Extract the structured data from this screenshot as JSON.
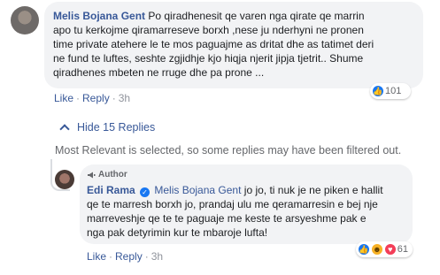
{
  "main_comment": {
    "author": "Melis Bojana Gent",
    "lines": [
      "Po qiradhenesit qe varen nga qirate qe marrin",
      "apo tu kerkojme qiramarreseve borxh ,nese ju nderhyni ne pronen",
      "time private atehere le te mos paguajme as dritat dhe as tatimet deri",
      "ne fund te luftes, seshte zgjidhje kjo hiqja njerit jipja tjetrit.. Shume",
      "qiradhenes mbeten ne rruge dhe pa prone ..."
    ],
    "reaction_count": "101",
    "actions": {
      "like": "Like",
      "reply": "Reply",
      "time": "3h"
    }
  },
  "replies_toggle": {
    "label": "Hide 15 Replies"
  },
  "filter_note": "Most Relevant is selected, so some replies may have been filtered out.",
  "reply": {
    "badge": "Author",
    "author": "Edi Rama",
    "mention": "Melis Bojana Gent",
    "first_line_text": " jo jo, ti nuk je ne piken e hallit",
    "lines": [
      "qe te marresh borxh jo, prandaj ulu me qeramarresin e bej nje",
      "marreveshje qe te te paguaje me keste te arsyeshme pak e",
      "nga pak detyrimin kur te mbaroje lufta!"
    ],
    "reaction_count": "61",
    "actions": {
      "like": "Like",
      "reply": "Reply",
      "time": "3h"
    }
  },
  "icons": {
    "like": "like-reaction-icon",
    "haha": "haha-reaction-icon",
    "love": "love-reaction-icon",
    "verified": "verified-badge-icon",
    "author": "megaphone-icon"
  },
  "colors": {
    "link": "#385898",
    "bubble": "#f2f3f5",
    "like": "#1877f2"
  }
}
